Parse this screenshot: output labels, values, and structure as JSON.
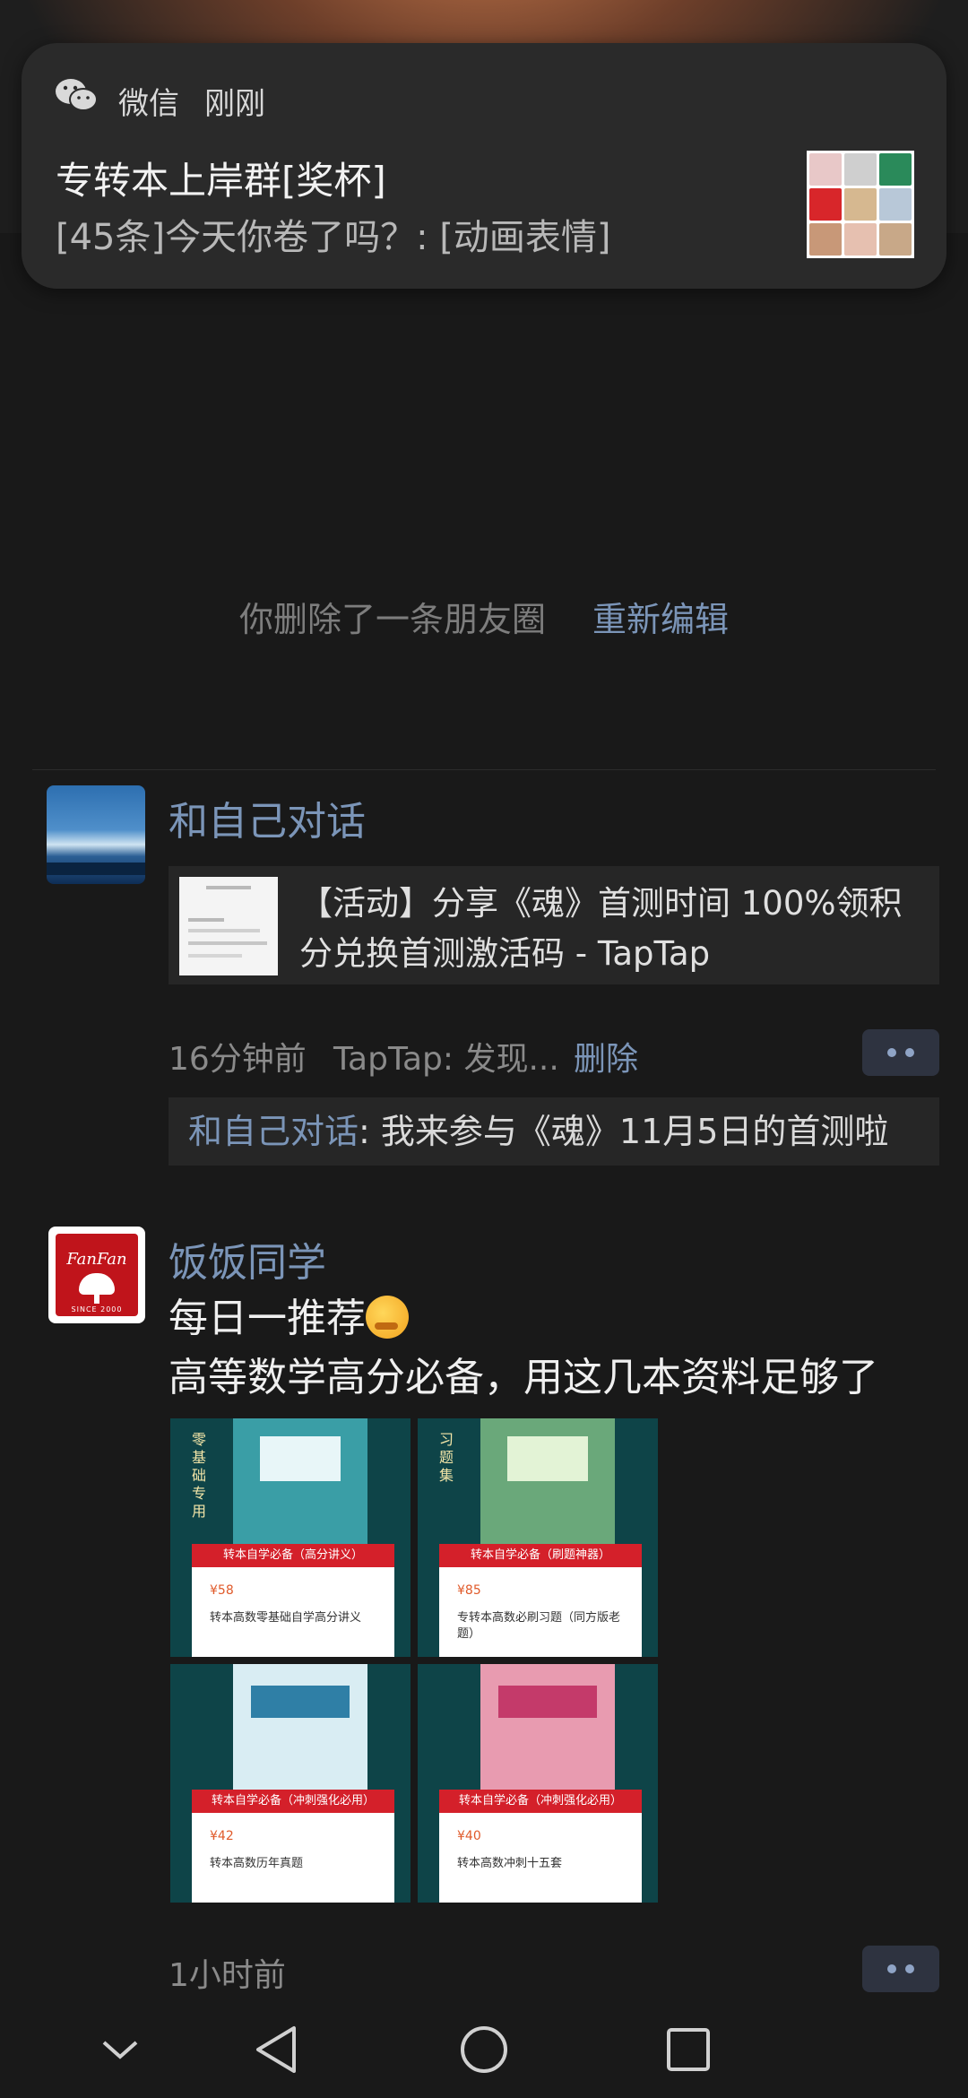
{
  "notification": {
    "app_name": "微信",
    "time": "刚刚",
    "title": "专转本上岸群[奖杯]",
    "body": "[45条]今天你卷了吗？: [动画表情]",
    "icon": "wechat-icon"
  },
  "deleted_notice": {
    "text": "你删除了一条朋友圈",
    "action": "重新编辑"
  },
  "posts": [
    {
      "author": "和自己对话",
      "link_title": "【活动】分享《魂》首测时间 100%领积分兑换首测激活码 - TapTap",
      "time": "16分钟前",
      "source": "TapTap: 发现...",
      "delete_label": "删除",
      "comment": {
        "author": "和自己对话",
        "text": ": 我来参与《魂》11月5日的首测啦"
      }
    },
    {
      "author": "饭饭同学",
      "avatar_text": "FanFan",
      "avatar_since": "SINCE 2000",
      "line1": "每日一推荐",
      "line2": "高等数学高分必备，用这几本资料足够了",
      "time": "1小时前",
      "images": [
        {
          "vertical": "零基础专用",
          "banner": "转本自学必备（高分讲义）",
          "price": "¥58",
          "desc": "转本高数零基础自学高分讲义"
        },
        {
          "vertical": "习题集",
          "banner": "转本自学必备（刷题神器）",
          "price": "¥85",
          "desc": "专转本高数必刷习题（同方版老题）"
        },
        {
          "vertical": "",
          "banner": "转本自学必备（冲刺强化必用）",
          "price": "¥42",
          "desc": "转本高数历年真题"
        },
        {
          "vertical": "",
          "banner": "转本自学必备（冲刺强化必用）",
          "price": "¥40",
          "desc": "转本高数冲刺十五套"
        }
      ]
    }
  ],
  "colors": {
    "background": "#191919",
    "link_blue": "#7b95b8",
    "card": "#262626"
  }
}
